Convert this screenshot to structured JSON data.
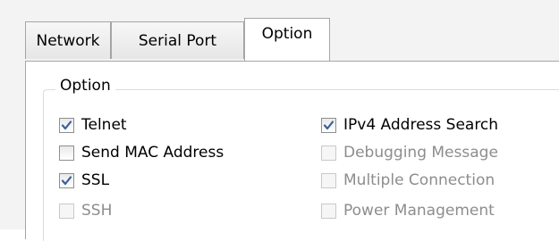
{
  "tabs": [
    {
      "label": "Network"
    },
    {
      "label": "Serial Port"
    },
    {
      "label": "Option"
    }
  ],
  "group": {
    "title": "Option"
  },
  "checkboxes_left": [
    {
      "label": "Telnet",
      "checked": true,
      "enabled": true
    },
    {
      "label": "Send MAC Address",
      "checked": false,
      "enabled": true
    },
    {
      "label": "SSL",
      "checked": true,
      "enabled": true
    },
    {
      "label": "SSH",
      "checked": false,
      "enabled": false
    }
  ],
  "checkboxes_right": [
    {
      "label": "IPv4 Address Search",
      "checked": true,
      "enabled": true
    },
    {
      "label": "Debugging Message",
      "checked": false,
      "enabled": false
    },
    {
      "label": "Multiple Connection",
      "checked": false,
      "enabled": false
    },
    {
      "label": "Power Management",
      "checked": false,
      "enabled": false
    }
  ],
  "colors": {
    "check": "#3a5f9a",
    "border": "#a5a5a5",
    "disabled_text": "#8d8d8d"
  }
}
